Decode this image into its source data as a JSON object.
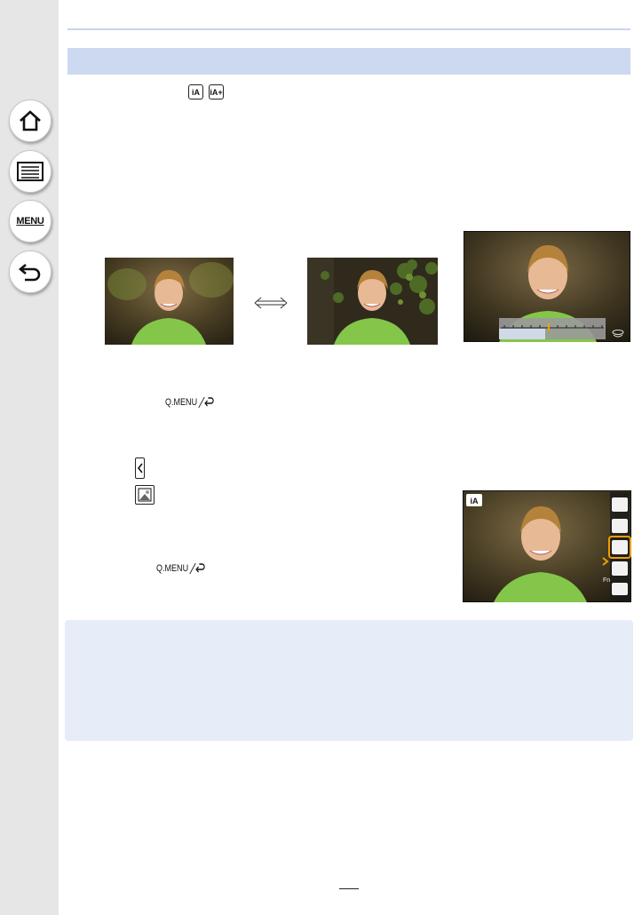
{
  "nav": {
    "home": "home-icon",
    "contents": "list-icon",
    "menu_label": "MENU",
    "back": "back-arrow-icon"
  },
  "mode_icons": {
    "intelligent_auto": "iA",
    "intelligent_auto_plus": "iA+"
  },
  "qmenu_label_1": "Q.MENU",
  "qmenu_label_2": "Q.MENU",
  "icons": {
    "left_arrow": "chevron-left-icon",
    "defocus_control": "defocus-control-icon",
    "compare_arrow": "double-arrow-icon"
  },
  "colors": {
    "section_bar": "#ccd9f0",
    "note_box": "#e6ecf8",
    "sidebar": "#e6e6e6",
    "highlight": "#f0a000"
  }
}
